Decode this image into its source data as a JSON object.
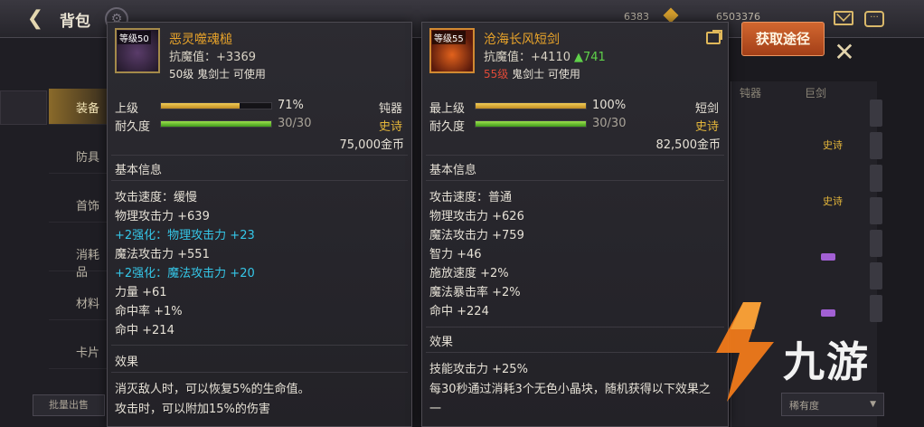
{
  "topbar": {
    "title": "背包",
    "currency_a": "6383",
    "currency_b": "6503376"
  },
  "side_tabs": [
    "装备",
    "防具",
    "首饰",
    "消耗品",
    "材料",
    "卡片"
  ],
  "filter_button": "批量出售",
  "right_panel": {
    "headers": [
      "钝器",
      "巨剑"
    ],
    "tags": [
      "史诗",
      "史诗"
    ],
    "dropdown": "稀有度"
  },
  "obtain_button": "获取途径",
  "watermark": {
    "text": "九游"
  },
  "left_card": {
    "level_tag": "等级50",
    "name": "恶灵噬魂槌",
    "stat_label": "抗魔值：",
    "stat_value": "+3369",
    "req_level": "50级",
    "req_rest": "鬼剑士 可使用",
    "grade_label": "上级",
    "grade_pct": 71,
    "grade_text": "71%",
    "weapon_type": "钝器",
    "durability_label": "耐久度",
    "durability_pct": 100,
    "durability_text": "30/30",
    "rarity": "史诗",
    "price": "75,000金币",
    "basic_title": "基本信息",
    "basic_lines": [
      {
        "text": "攻击速度：缓慢",
        "cyan": false
      },
      {
        "text": "物理攻击力 +639",
        "cyan": false
      },
      {
        "text": "+2强化：物理攻击力 +23",
        "cyan": true
      },
      {
        "text": "魔法攻击力 +551",
        "cyan": false
      },
      {
        "text": "+2强化：魔法攻击力 +20",
        "cyan": true
      },
      {
        "text": "力量 +61",
        "cyan": false
      },
      {
        "text": "命中率 +1%",
        "cyan": false
      },
      {
        "text": "命中 +214",
        "cyan": false
      }
    ],
    "effect_title": "效果",
    "effect_lines": [
      "消灭敌人时，可以恢复5%的生命值。",
      "攻击时，可以附加15%的伤害"
    ]
  },
  "right_card": {
    "level_tag": "等级55",
    "name": "沧海长风短剑",
    "stat_label": "抗魔值：",
    "stat_value": "+4110",
    "stat_gain": "▲741",
    "req_level": "55级",
    "req_rest": "鬼剑士 可使用",
    "grade_label": "最上级",
    "grade_pct": 100,
    "grade_text": "100%",
    "weapon_type": "短剑",
    "durability_label": "耐久度",
    "durability_pct": 100,
    "durability_text": "30/30",
    "rarity": "史诗",
    "price": "82,500金币",
    "basic_title": "基本信息",
    "basic_lines": [
      {
        "text": "攻击速度：普通",
        "cyan": false
      },
      {
        "text": "物理攻击力 +626",
        "cyan": false
      },
      {
        "text": "魔法攻击力 +759",
        "cyan": false
      },
      {
        "text": "智力 +46",
        "cyan": false
      },
      {
        "text": "施放速度 +2%",
        "cyan": false
      },
      {
        "text": "魔法暴击率 +2%",
        "cyan": false
      },
      {
        "text": "命中 +224",
        "cyan": false
      }
    ],
    "effect_title": "效果",
    "effect_lines": [
      "技能攻击力 +25%",
      "每30秒通过消耗3个无色小晶块，随机获得以下效果之",
      "一"
    ]
  }
}
